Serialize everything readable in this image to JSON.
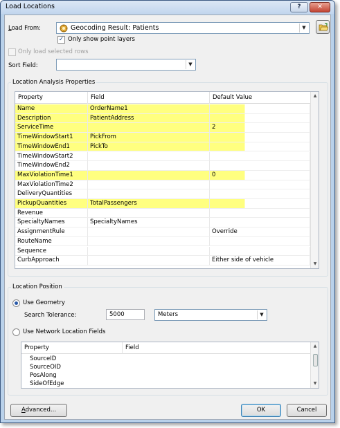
{
  "window": {
    "title": "Load Locations",
    "help_glyph": "?",
    "close_glyph": "✕"
  },
  "load_from": {
    "label": "Load From:",
    "value": "Geocoding Result: Patients",
    "only_point_layers_label": "Only show point layers",
    "only_point_layers_checked": true
  },
  "only_selected_rows_label": "Only load selected rows",
  "sort_field": {
    "label": "Sort Field:",
    "value": ""
  },
  "properties_group": {
    "title": "Location Analysis Properties",
    "columns": [
      "Property",
      "Field",
      "Default Value"
    ],
    "rows": [
      {
        "property": "Name",
        "field": "OrderName1",
        "default": "",
        "highlight": true
      },
      {
        "property": "Description",
        "field": "PatientAddress",
        "default": "",
        "highlight": true
      },
      {
        "property": "ServiceTime",
        "field": "",
        "default": "2",
        "highlight": true
      },
      {
        "property": "TimeWindowStart1",
        "field": "PickFrom",
        "default": "",
        "highlight": true
      },
      {
        "property": "TimeWindowEnd1",
        "field": "PickTo",
        "default": "",
        "highlight": true
      },
      {
        "property": "TimeWindowStart2",
        "field": "",
        "default": "",
        "highlight": false
      },
      {
        "property": "TimeWindowEnd2",
        "field": "",
        "default": "",
        "highlight": false
      },
      {
        "property": "MaxViolationTime1",
        "field": "",
        "default": "0",
        "highlight": true
      },
      {
        "property": "MaxViolationTime2",
        "field": "",
        "default": "",
        "highlight": false
      },
      {
        "property": "DeliveryQuantities",
        "field": "",
        "default": "",
        "highlight": false
      },
      {
        "property": "PickupQuantities",
        "field": "TotalPassengers",
        "default": "",
        "highlight": true
      },
      {
        "property": "Revenue",
        "field": "",
        "default": "",
        "highlight": false
      },
      {
        "property": "SpecialtyNames",
        "field": "SpecialtyNames",
        "default": "",
        "highlight": false
      },
      {
        "property": "AssignmentRule",
        "field": "",
        "default": "Override",
        "highlight": false
      },
      {
        "property": "RouteName",
        "field": "",
        "default": "",
        "highlight": false
      },
      {
        "property": "Sequence",
        "field": "",
        "default": "",
        "highlight": false
      },
      {
        "property": "CurbApproach",
        "field": "",
        "default": "Either side of vehicle",
        "highlight": false
      }
    ]
  },
  "position_group": {
    "title": "Location Position",
    "use_geometry_label": "Use Geometry",
    "use_geometry_selected": true,
    "search_tolerance_label": "Search Tolerance:",
    "search_tolerance_value": "5000",
    "units_value": "Meters",
    "use_network_fields_label": "Use Network Location Fields",
    "network_columns": [
      "Property",
      "Field"
    ],
    "network_rows": [
      "SourceID",
      "SourceOID",
      "PosAlong",
      "SideOfEdge"
    ]
  },
  "buttons": {
    "advanced": "Advanced...",
    "ok": "OK",
    "cancel": "Cancel"
  },
  "colors": {
    "highlight": "#ffff80",
    "title_bar": "#c2d6ee",
    "close_button": "#c24433"
  }
}
